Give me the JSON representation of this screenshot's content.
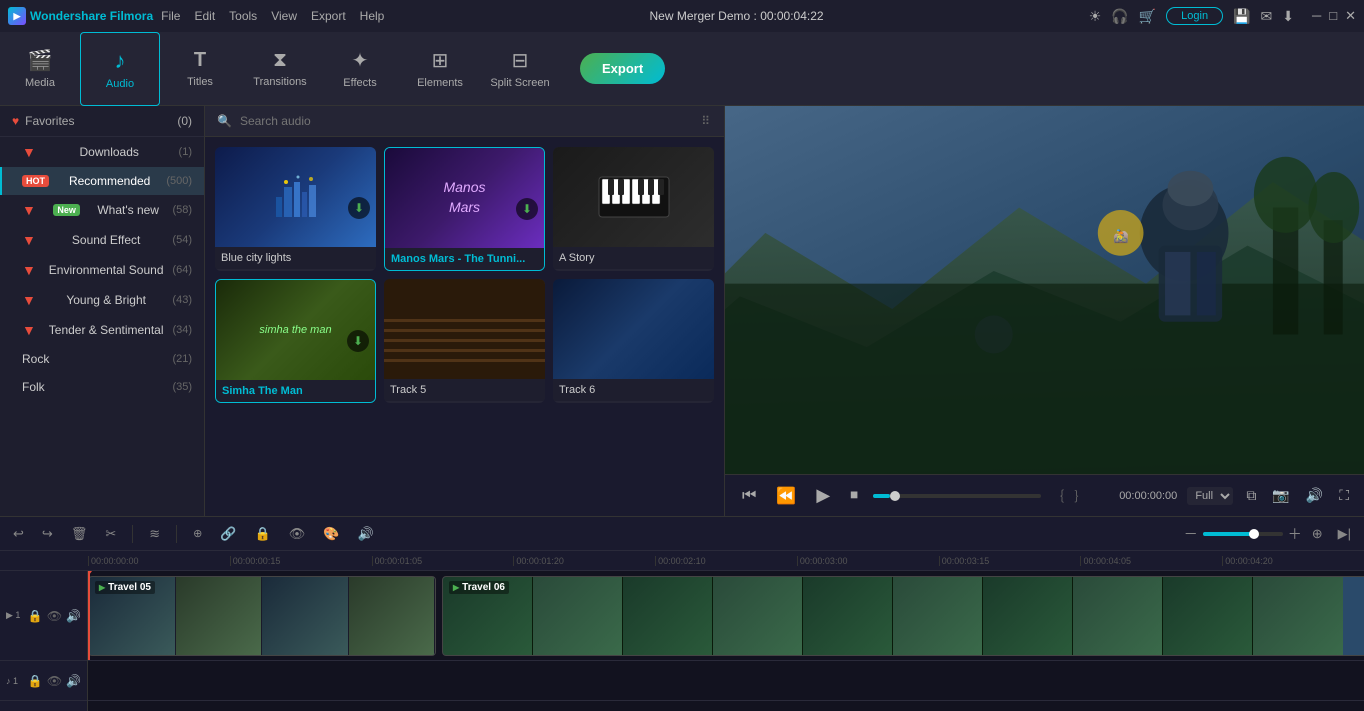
{
  "titlebar": {
    "logo": "Wondershare Filmora",
    "menu": [
      "File",
      "Edit",
      "Tools",
      "View",
      "Export",
      "Help"
    ],
    "project_title": "New Merger Demo : 00:00:04:22",
    "login_label": "Login"
  },
  "toolbar": {
    "items": [
      {
        "id": "media",
        "label": "Media",
        "icon": "🎬"
      },
      {
        "id": "audio",
        "label": "Audio",
        "icon": "♪"
      },
      {
        "id": "titles",
        "label": "Titles",
        "icon": "T"
      },
      {
        "id": "transitions",
        "label": "Transitions",
        "icon": "⧗"
      },
      {
        "id": "effects",
        "label": "Effects",
        "icon": "✦"
      },
      {
        "id": "elements",
        "label": "Elements",
        "icon": "⊞"
      },
      {
        "id": "split_screen",
        "label": "Split Screen",
        "icon": "⊟"
      }
    ],
    "export_label": "Export"
  },
  "sidebar": {
    "favorites": {
      "label": "Favorites",
      "count": "(0)"
    },
    "items": [
      {
        "id": "downloads",
        "label": "Downloads",
        "count": "(1)",
        "badge": null,
        "active": false
      },
      {
        "id": "recommended",
        "label": "Recommended",
        "count": "(500)",
        "badge": "HOT",
        "badge_color": "#e74c3c",
        "active": true
      },
      {
        "id": "whats_new",
        "label": "What's new",
        "count": "(58)",
        "badge": "New",
        "badge_color": "#4caf50",
        "active": false
      },
      {
        "id": "sound_effect",
        "label": "Sound Effect",
        "count": "(54)",
        "badge": null,
        "active": false
      },
      {
        "id": "environmental_sound",
        "label": "Environmental Sound",
        "count": "(64)",
        "badge": null,
        "active": false
      },
      {
        "id": "young_bright",
        "label": "Young & Bright",
        "count": "(43)",
        "badge": null,
        "active": false
      },
      {
        "id": "tender_sentimental",
        "label": "Tender & Sentimental",
        "count": "(34)",
        "badge": null,
        "active": false
      },
      {
        "id": "rock",
        "label": "Rock",
        "count": "(21)",
        "badge": null,
        "active": false
      },
      {
        "id": "folk",
        "label": "Folk",
        "count": "(35)",
        "badge": null,
        "active": false
      }
    ]
  },
  "search": {
    "placeholder": "Search audio"
  },
  "audio_cards": [
    {
      "id": 1,
      "title": "Blue city lights",
      "has_download": true,
      "highlighted": false,
      "bg": "1"
    },
    {
      "id": 2,
      "title": "Manos Mars - The Tunni...",
      "has_download": true,
      "highlighted": true,
      "bg": "2"
    },
    {
      "id": 3,
      "title": "A Story",
      "has_download": false,
      "highlighted": false,
      "bg": "3"
    },
    {
      "id": 4,
      "title": "Simha The Man",
      "has_download": true,
      "highlighted": true,
      "bg": "4"
    },
    {
      "id": 5,
      "title": "Track 5",
      "has_download": false,
      "highlighted": false,
      "bg": "5"
    },
    {
      "id": 6,
      "title": "Track 6",
      "has_download": false,
      "highlighted": false,
      "bg": "6"
    }
  ],
  "playback": {
    "time": "00:00:00:00",
    "quality": "Full"
  },
  "timeline": {
    "ruler_marks": [
      "00:00:00:00",
      "00:00:00:15",
      "00:00:01:05",
      "00:00:01:20",
      "00:00:02:10",
      "00:00:03:00",
      "00:00:03:15",
      "00:00:04:05",
      "00:00:04:20"
    ],
    "clips": [
      {
        "label": "Travel 05",
        "track": 1
      },
      {
        "label": "Travel 06",
        "track": 1
      }
    ]
  }
}
